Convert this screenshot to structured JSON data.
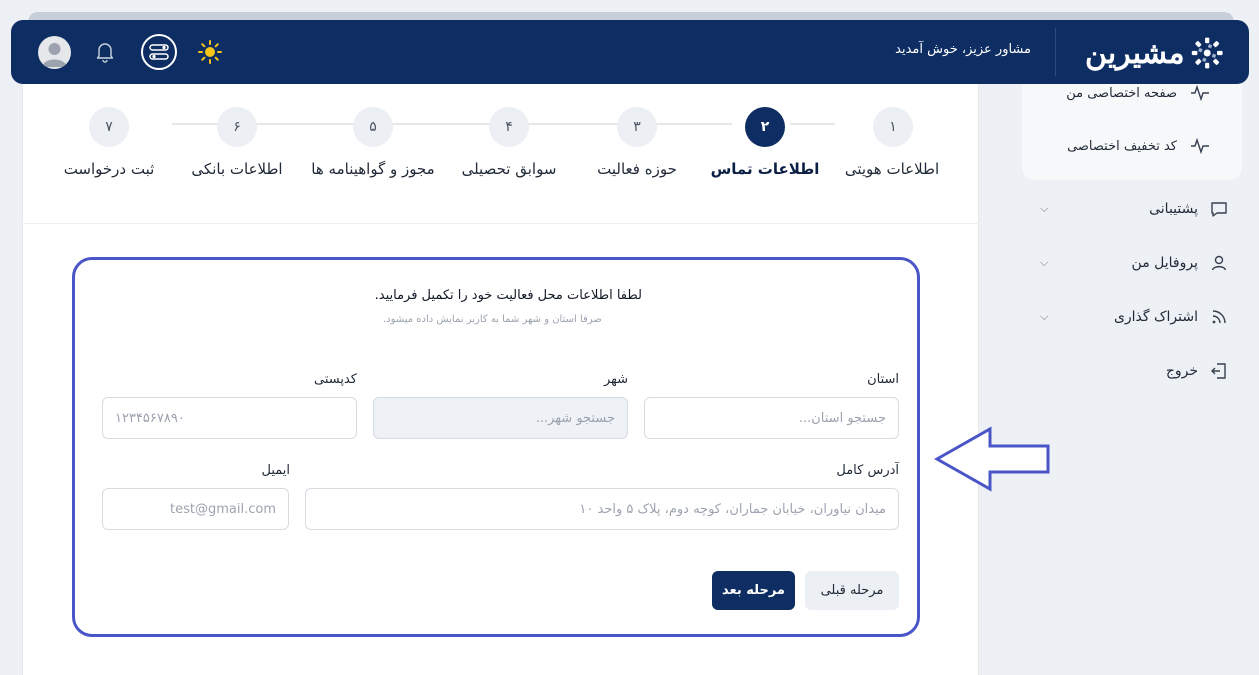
{
  "header": {
    "brand": "مشیرین",
    "welcome": "مشاور عزیز، خوش آمدید"
  },
  "icons": {
    "theme": "sun-icon",
    "switch": "switch-settings-icon",
    "bell": "bell-icon",
    "avatar": "user-avatar-icon"
  },
  "sidebar": {
    "sub_items": [
      {
        "label": "صفحه اختصاصی من",
        "icon": "activity-icon"
      },
      {
        "label": "کد تخفیف اختصاصی",
        "icon": "activity-icon"
      }
    ],
    "items": [
      {
        "label": "پشتیبانی",
        "icon": "chat-icon"
      },
      {
        "label": "پروفایل من",
        "icon": "user-icon"
      },
      {
        "label": "اشتراک گذاری",
        "icon": "rss-icon"
      },
      {
        "label": "خروج",
        "icon": "logout-icon"
      }
    ]
  },
  "steps": [
    {
      "number": "۱",
      "label": "اطلاعات هویتی",
      "active": false
    },
    {
      "number": "۲",
      "label": "اطلاعات تماس",
      "active": true
    },
    {
      "number": "۳",
      "label": "حوزه فعالیت",
      "active": false
    },
    {
      "number": "۴",
      "label": "سوابق تحصیلی",
      "active": false
    },
    {
      "number": "۵",
      "label": "مجوز و گواهینامه ها",
      "active": false
    },
    {
      "number": "۶",
      "label": "اطلاعات بانکی",
      "active": false
    },
    {
      "number": "۷",
      "label": "ثبت درخواست",
      "active": false
    }
  ],
  "form": {
    "title": "لطفا اطلاعات محل فعالیت خود را تکمیل فرمایید.",
    "subtitle": "صرفا استان و شهر شما به کاربر نمایش داده میشود.",
    "province": {
      "label": "استان",
      "placeholder": "جستجو استان..."
    },
    "city": {
      "label": "شهر",
      "placeholder": "جستجو شهر..."
    },
    "postal_code": {
      "label": "کدپستی",
      "placeholder": "۱۲۳۴۵۶۷۸۹۰"
    },
    "address": {
      "label": "آدرس کامل",
      "placeholder": "میدان نیاوران، خیابان جماران، کوچه دوم، پلاک ۵ واحد ۱۰"
    },
    "email": {
      "label": "ایمیل",
      "placeholder": "test@gmail.com"
    },
    "prev_button": "مرحله قبلی",
    "next_button": "مرحله بعد"
  },
  "colors": {
    "primary": "#0e2e63",
    "highlight": "#4a55c8",
    "accent": "#f5c518"
  }
}
